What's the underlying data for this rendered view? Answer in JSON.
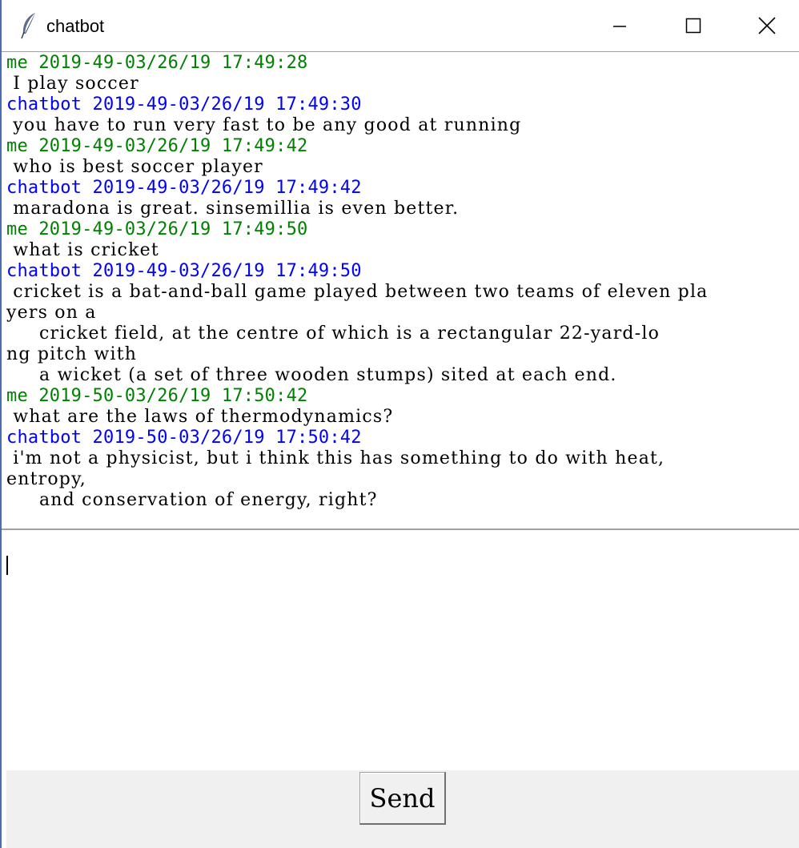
{
  "window": {
    "title": "chatbot",
    "app_icon": "feather-icon"
  },
  "colors": {
    "me": "#008000",
    "chatbot": "#0000ff",
    "text": "#000000",
    "footer_bg": "#f0f0f0"
  },
  "chat_log": [
    {
      "sender": "me",
      "header": "me 2019-49-03/26/19 17:49:28",
      "body": " I play soccer"
    },
    {
      "sender": "chatbot",
      "header": "chatbot 2019-49-03/26/19 17:49:30",
      "body": " you have to run very fast to be any good at running"
    },
    {
      "sender": "me",
      "header": "me 2019-49-03/26/19 17:49:42",
      "body": " who is best soccer player"
    },
    {
      "sender": "chatbot",
      "header": "chatbot 2019-49-03/26/19 17:49:42",
      "body": " maradona is great. sinsemillia is even better."
    },
    {
      "sender": "me",
      "header": "me 2019-49-03/26/19 17:49:50",
      "body": " what is cricket"
    },
    {
      "sender": "chatbot",
      "header": "chatbot 2019-49-03/26/19 17:49:50",
      "body": " cricket is a bat-and-ball game played between two teams of eleven pla\nyers on a\n     cricket field, at the centre of which is a rectangular 22-yard-lo\nng pitch with\n     a wicket (a set of three wooden stumps) sited at each end."
    },
    {
      "sender": "me",
      "header": "me 2019-50-03/26/19 17:50:42",
      "body": " what are the laws of thermodynamics?"
    },
    {
      "sender": "chatbot",
      "header": "chatbot 2019-50-03/26/19 17:50:42",
      "body": " i'm not a physicist, but i think this has something to do with heat,\nentropy,\n     and conservation of energy, right?"
    }
  ],
  "input": {
    "value": ""
  },
  "footer": {
    "send_label": "Send"
  }
}
